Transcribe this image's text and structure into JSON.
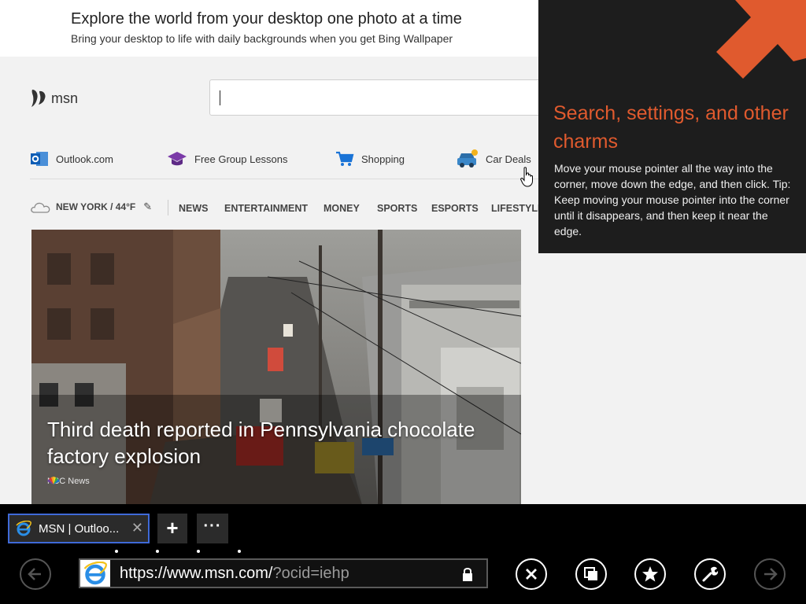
{
  "banner": {
    "title": "Explore the world from your desktop one photo at a time",
    "subtitle": "Bring your desktop to life with daily backgrounds when you get Bing Wallpaper"
  },
  "msn": {
    "logo_text": "msn",
    "search_value": ""
  },
  "quick_links": [
    {
      "label": "Outlook.com",
      "icon": "outlook-icon"
    },
    {
      "label": "Free Group Lessons",
      "icon": "graduation-cap-icon"
    },
    {
      "label": "Shopping",
      "icon": "shopping-cart-icon"
    },
    {
      "label": "Car Deals",
      "icon": "car-icon"
    }
  ],
  "weather": {
    "label": "NEW YORK / 44°F",
    "icon": "cloud-icon",
    "edit_icon": "pencil-icon",
    "edit_glyph": "✎"
  },
  "nav": [
    "NEWS",
    "ENTERTAINMENT",
    "MONEY",
    "SPORTS",
    "ESPORTS",
    "LIFESTYLE"
  ],
  "hero": {
    "headline": "Third death reported in Pennsylvania chocolate factory explosion",
    "source": "NBC News"
  },
  "charms_tip": {
    "title": "Search, settings, and other charms",
    "body": "Move your mouse pointer all the way into the corner, move down the edge, and then click. Tip: Keep moving your mouse pointer into the corner until it disappears, and then keep it near the edge.",
    "accent_color": "#e05a2e"
  },
  "browser": {
    "tab_title": "MSN | Outloo...",
    "tab_close": "✕",
    "new_tab": "+",
    "tab_more": "···",
    "url_host": "https://www.msn.com/",
    "url_path": "?ocid=iehp",
    "buttons": [
      "back-icon",
      "stop-icon",
      "tabs-icon",
      "favorites-icon",
      "tools-icon",
      "forward-icon"
    ]
  }
}
